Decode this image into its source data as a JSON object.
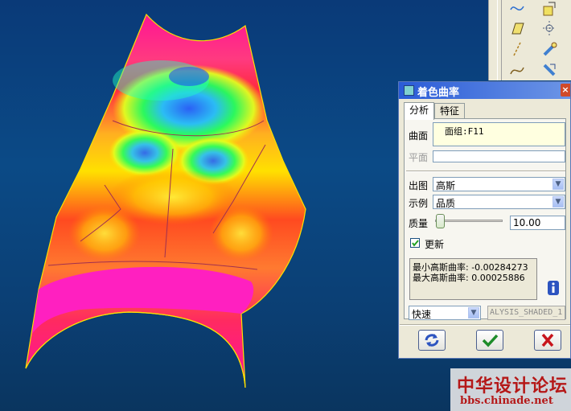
{
  "dialog": {
    "title": "着色曲率",
    "close": "×",
    "tabs": [
      "分析",
      "特征"
    ],
    "surface_label": "曲面",
    "surface_value": "面组:F11",
    "plane_label": "平面",
    "output_label": "出图",
    "output_value": "高斯",
    "display_label": "示例",
    "display_value": "品质",
    "quality_label": "质量",
    "quality_value": "10.00",
    "update_label": "更新",
    "update_checked": true,
    "results": {
      "min": "最小高斯曲率: -0.00284273",
      "max": "最大高斯曲率: 0.00025886"
    },
    "mode_value": "快速",
    "analysis_name": "ALYSIS_SHADED_1"
  },
  "watermark": {
    "line1": "中华设计论坛",
    "line2": "bbs.chinade.net"
  },
  "colors": {
    "titlebar": "#2a5bd7",
    "background": "#0b4a86",
    "ok": "#1e8c2a",
    "cancel": "#c8141c"
  }
}
